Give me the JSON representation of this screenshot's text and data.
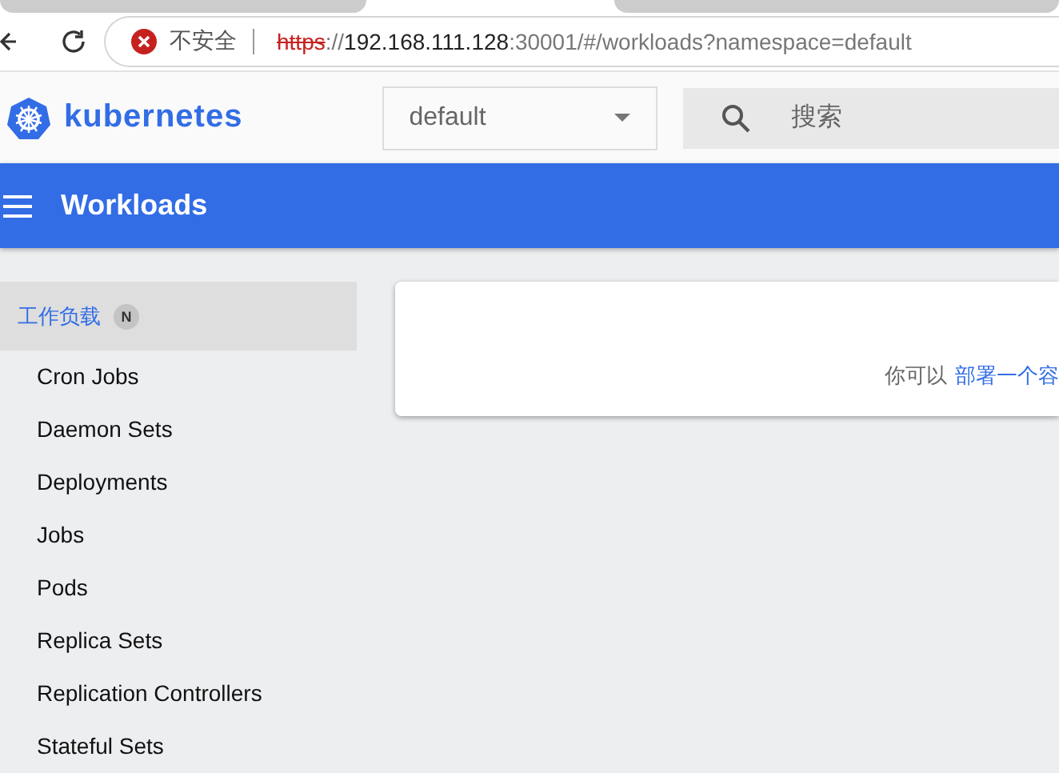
{
  "browser": {
    "security_label": "不安全",
    "url": [
      {
        "kind": "insecure",
        "text": "https"
      },
      {
        "kind": "dim",
        "text": "://"
      },
      {
        "kind": "host",
        "text": "192.168.111.128"
      },
      {
        "kind": "dim",
        "text": ":30001/#/workloads?namespace=default"
      }
    ]
  },
  "header": {
    "logo_text": "kubernetes",
    "namespace": "default",
    "search": {
      "placeholder": "搜索"
    }
  },
  "toolbar": {
    "title": "Workloads"
  },
  "sidebar": {
    "section": {
      "label": "工作负载",
      "badge": "N",
      "selected": true
    },
    "items": [
      {
        "label": "Cron Jobs",
        "selected": false
      },
      {
        "label": "Daemon Sets",
        "selected": false
      },
      {
        "label": "Deployments",
        "selected": false
      },
      {
        "label": "Jobs",
        "selected": false
      },
      {
        "label": "Pods",
        "selected": false
      },
      {
        "label": "Replica Sets",
        "selected": false
      },
      {
        "label": "Replication Controllers",
        "selected": false
      },
      {
        "label": "Stateful Sets",
        "selected": false
      }
    ]
  },
  "card": {
    "text": "你可以",
    "link": "部署一个容"
  }
}
